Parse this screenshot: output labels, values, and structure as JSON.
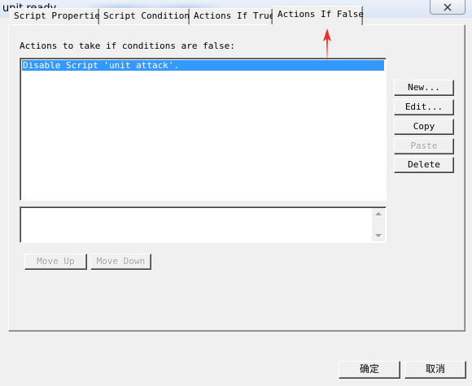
{
  "window": {
    "title": "unit ready"
  },
  "tabs": [
    {
      "label": "Script Properties"
    },
    {
      "label": "Script Conditions"
    },
    {
      "label": "Actions If True"
    },
    {
      "label": "Actions If False"
    }
  ],
  "panel": {
    "label": "Actions to take if conditions are false:",
    "actions": [
      "Disable Script 'unit attack'."
    ],
    "selected_index": 0
  },
  "side_buttons": {
    "new": "New...",
    "edit": "Edit...",
    "copy": "Copy",
    "paste": "Paste",
    "delete": "Delete"
  },
  "move_buttons": {
    "up": "Move Up",
    "down": "Move Down"
  },
  "dialog_buttons": {
    "ok": "确定",
    "cancel": "取消"
  },
  "colors": {
    "selection": "#3399ff",
    "annotation_arrow": "#e8302a"
  }
}
